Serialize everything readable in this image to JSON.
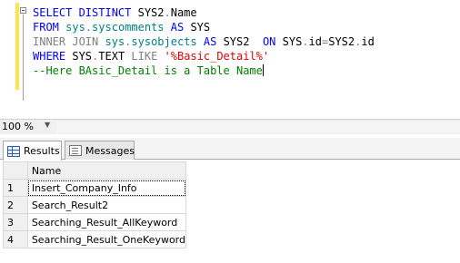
{
  "editor": {
    "lines": [
      {
        "parts": [
          {
            "t": "SELECT DISTINCT ",
            "c": "kw"
          },
          {
            "t": "SYS2",
            "c": "plain"
          },
          {
            "t": ".",
            "c": "gray"
          },
          {
            "t": "Name",
            "c": "plain"
          }
        ]
      },
      {
        "parts": [
          {
            "t": "FROM ",
            "c": "kw"
          },
          {
            "t": "sys",
            "c": "teal"
          },
          {
            "t": ".",
            "c": "gray"
          },
          {
            "t": "syscomments ",
            "c": "teal"
          },
          {
            "t": "AS ",
            "c": "kw"
          },
          {
            "t": "SYS",
            "c": "plain"
          }
        ]
      },
      {
        "parts": [
          {
            "t": "INNER JOIN ",
            "c": "gray"
          },
          {
            "t": "sys",
            "c": "teal"
          },
          {
            "t": ".",
            "c": "gray"
          },
          {
            "t": "sysobjects ",
            "c": "teal"
          },
          {
            "t": "AS ",
            "c": "kw"
          },
          {
            "t": "SYS2  ",
            "c": "plain"
          },
          {
            "t": "ON ",
            "c": "kw"
          },
          {
            "t": "SYS",
            "c": "plain"
          },
          {
            "t": ".",
            "c": "gray"
          },
          {
            "t": "id",
            "c": "plain"
          },
          {
            "t": "=",
            "c": "gray"
          },
          {
            "t": "SYS2",
            "c": "plain"
          },
          {
            "t": ".",
            "c": "gray"
          },
          {
            "t": "id",
            "c": "plain"
          }
        ]
      },
      {
        "parts": [
          {
            "t": "WHERE ",
            "c": "kw"
          },
          {
            "t": "SYS",
            "c": "plain"
          },
          {
            "t": ".",
            "c": "gray"
          },
          {
            "t": "TEXT ",
            "c": "plain"
          },
          {
            "t": "LIKE ",
            "c": "gray"
          },
          {
            "t": "'%Basic_Detail%'",
            "c": "str"
          }
        ]
      },
      {
        "parts": [
          {
            "t": "--Here BAsic_Detail is a Table Name",
            "c": "cmt"
          }
        ]
      }
    ]
  },
  "zoom": {
    "value": "100 %"
  },
  "tabs": {
    "results": "Results",
    "messages": "Messages"
  },
  "grid": {
    "column": "Name",
    "rows": [
      {
        "num": "1",
        "name": "Insert_Company_Info"
      },
      {
        "num": "2",
        "name": "Search_Result2"
      },
      {
        "num": "3",
        "name": "Searching_Result_AllKeyword"
      },
      {
        "num": "4",
        "name": "Searching_Result_OneKeyword"
      }
    ]
  }
}
